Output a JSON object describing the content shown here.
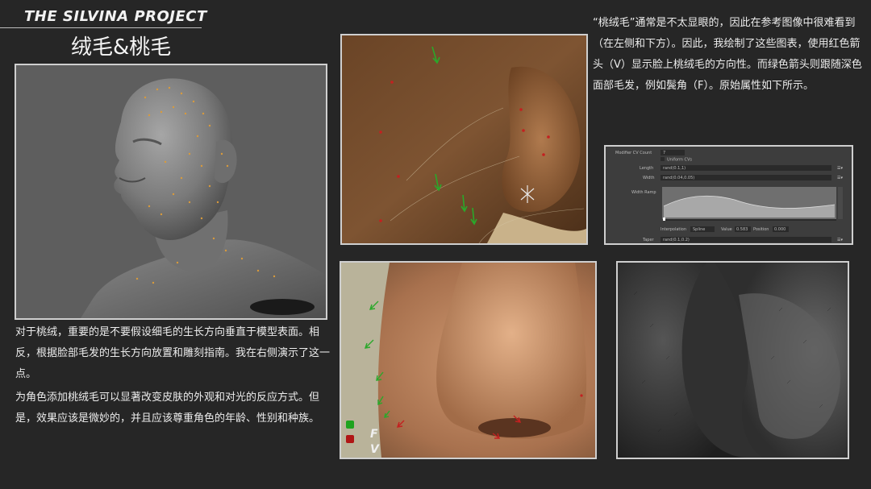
{
  "header": {
    "project_title": "THE SILVINA PROJECT",
    "section_title": "绒毛&桃毛"
  },
  "paragraphs": {
    "right_intro": "“桃绒毛”通常是不太显眼的，因此在参考图像中很难看到（在左侧和下方）。因此，我绘制了这些图表，使用红色箭头（V）显示脸上桃绒毛的方向性。而绿色箭头则跟随深色面部毛发，例如鬓角（F）。原始属性如下所示。",
    "left_1": "对于桃绒，重要的是不要假设细毛的生长方向垂直于模型表面。相反，根据脸部毛发的生长方向放置和雕刻指南。我在右侧演示了这一点。",
    "left_2": "为角色添加桃绒毛可以显著改变皮肤的外观和对光的反应方式。但是，效果应该是微妙的，并且应该尊重角色的年龄、性别和种族。"
  },
  "legend": {
    "green_label": "F",
    "red_label": "V",
    "green_color": "#1fa31f",
    "red_color": "#b01515"
  },
  "attribute_panel": {
    "modifier_cv_count_label": "Modifier CV Count",
    "modifier_cv_count_value": "7",
    "uniform_cvs_label": "Uniform CVs",
    "length_label": "Length",
    "length_value": "rand(0.1,1)",
    "width_label": "Width",
    "width_value": "rand(0.04,0.05)",
    "width_ramp_label": "Width Ramp",
    "interpolation_label": "Interpolation",
    "interpolation_value": "Spline",
    "value_label": "Value",
    "value_value": "0.583",
    "position_label": "Position",
    "position_value": "0.000",
    "taper_label": "Taper",
    "taper_value": "rand(0.1,0.2)"
  },
  "colors": {
    "background": "#262626",
    "frame_border": "#cfcfcf",
    "arrow_green": "#2aa82a",
    "arrow_red": "#c42020",
    "ui_panel": "#3d3d3d",
    "ui_field": "#2a2a2a"
  }
}
